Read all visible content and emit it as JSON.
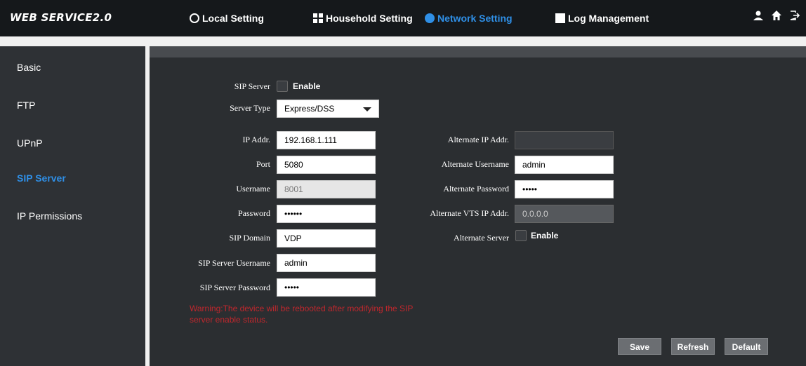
{
  "header": {
    "logo": "WEB SERVICE2.0",
    "nav": [
      {
        "label": "Local Setting"
      },
      {
        "label": "Household Setting"
      },
      {
        "label": "Network Setting"
      },
      {
        "label": "Log Management"
      }
    ],
    "icons": [
      "user-icon",
      "home-icon",
      "logout-icon"
    ]
  },
  "sidebar": {
    "items": [
      {
        "label": "Basic"
      },
      {
        "label": "FTP"
      },
      {
        "label": "UPnP"
      },
      {
        "label": "SIP Server"
      },
      {
        "label": "IP Permissions"
      }
    ]
  },
  "form": {
    "sip_server_label": "SIP Server",
    "sip_server_enable_label": "Enable",
    "server_type_label": "Server Type",
    "server_type_value": "Express/DSS",
    "ip_addr_label": "IP Addr.",
    "ip_addr_value": "192.168.1.111",
    "port_label": "Port",
    "port_value": "5080",
    "username_label": "Username",
    "username_value": "8001",
    "password_label": "Password",
    "password_value": "••••••",
    "sip_domain_label": "SIP Domain",
    "sip_domain_value": "VDP",
    "sip_server_username_label": "SIP Server Username",
    "sip_server_username_value": "admin",
    "sip_server_password_label": "SIP Server Password",
    "sip_server_password_value": "•••••",
    "alt_ip_label": "Alternate IP Addr.",
    "alt_ip_value": "",
    "alt_username_label": "Alternate Username",
    "alt_username_value": "admin",
    "alt_password_label": "Alternate Password",
    "alt_password_value": "•••••",
    "alt_vts_label": "Alternate VTS IP Addr.",
    "alt_vts_value": "0.0.0.0",
    "alt_server_label": "Alternate Server",
    "alt_server_enable_label": "Enable",
    "warning": "Warning:The device will be rebooted after modifying the SIP server enable status."
  },
  "buttons": {
    "save": "Save",
    "refresh": "Refresh",
    "default": "Default"
  },
  "colors": {
    "accent": "#2f8fe6",
    "warning": "#c0272d"
  }
}
